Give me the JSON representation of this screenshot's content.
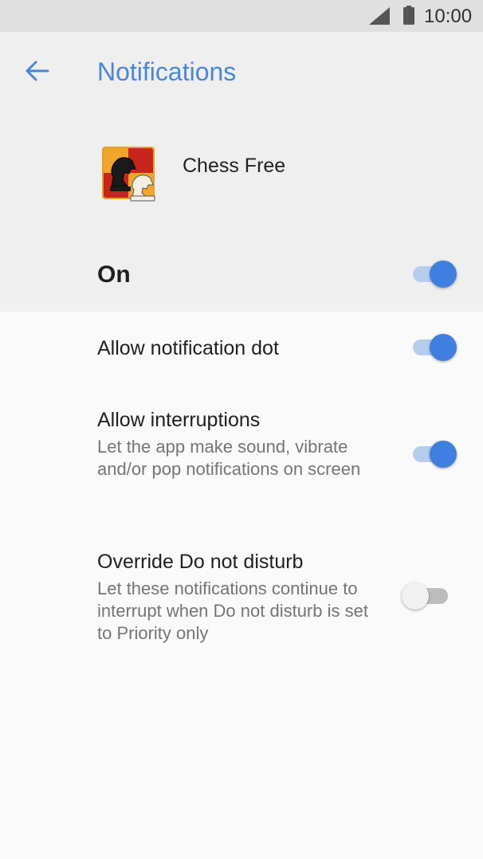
{
  "status_bar": {
    "time": "10:00",
    "signal_icon": "cell-signal-icon",
    "battery_icon": "battery-full-icon"
  },
  "header": {
    "back_icon": "arrow-back-icon",
    "title": "Notifications"
  },
  "app": {
    "name": "Chess Free",
    "icon": "chess-knights-app-icon"
  },
  "master_switch": {
    "label": "On",
    "checked": true
  },
  "settings": [
    {
      "title": "Allow notification dot",
      "summary": "",
      "checked": true
    },
    {
      "title": "Allow interruptions",
      "summary": "Let the app make sound, vibrate and/or pop notifications on screen",
      "checked": true
    },
    {
      "title": "Override Do not disturb",
      "summary": "Let these notifications continue to interrupt when Do not disturb is set to Priority only",
      "checked": false
    }
  ],
  "colors": {
    "accent": "#3f7fe0",
    "title": "#4a86d9",
    "header_bg": "#efeff0",
    "body_bg": "#fafafa"
  }
}
